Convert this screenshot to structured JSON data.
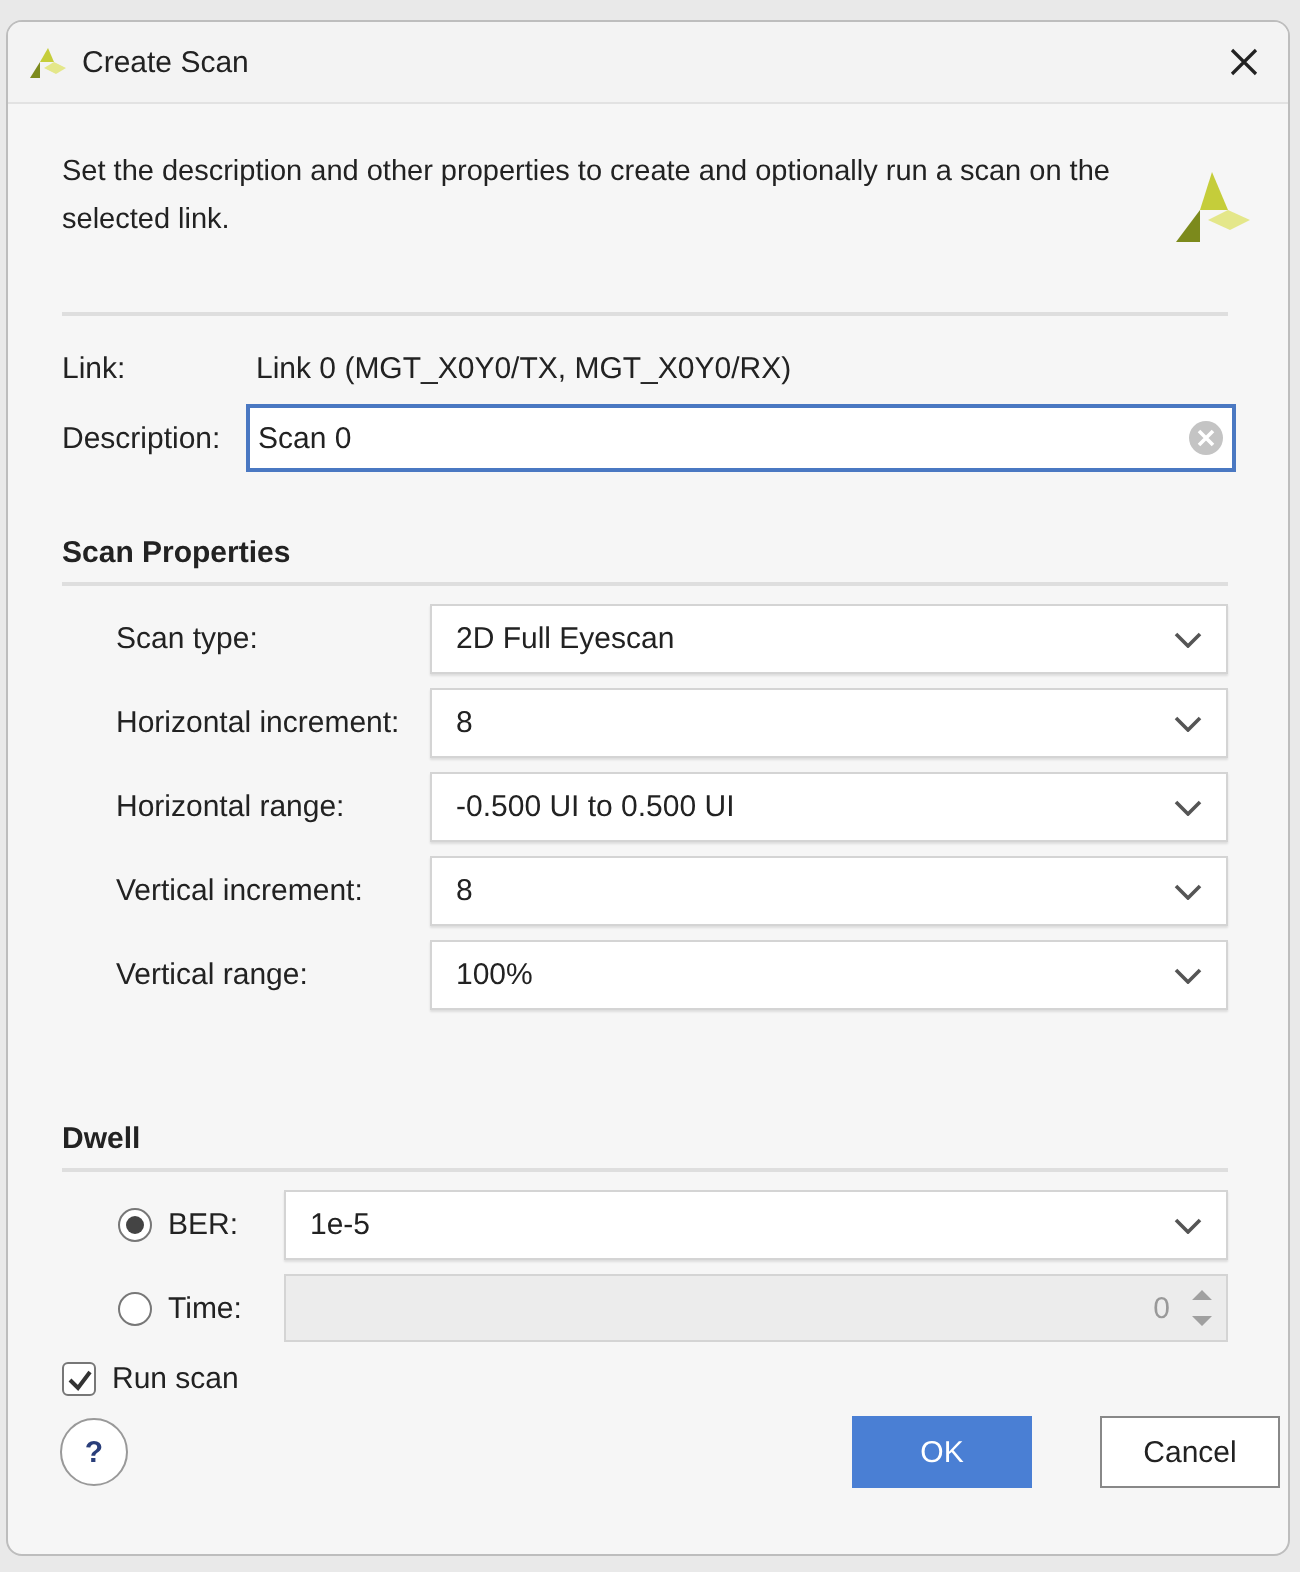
{
  "window": {
    "title": "Create Scan"
  },
  "intro": "Set the description and other properties to create and optionally run a scan on the selected link.",
  "link": {
    "label": "Link:",
    "value": "Link 0 (MGT_X0Y0/TX, MGT_X0Y0/RX)"
  },
  "description": {
    "label": "Description:",
    "value": "Scan 0"
  },
  "scan_properties": {
    "title": "Scan Properties",
    "fields": [
      {
        "label": "Scan type:",
        "value": "2D Full Eyescan"
      },
      {
        "label": "Horizontal increment:",
        "value": "8"
      },
      {
        "label": "Horizontal range:",
        "value": "-0.500 UI to 0.500 UI"
      },
      {
        "label": "Vertical increment:",
        "value": "8"
      },
      {
        "label": "Vertical range:",
        "value": "100%"
      }
    ]
  },
  "dwell": {
    "title": "Dwell",
    "options": [
      {
        "label": "BER:",
        "selected": true,
        "kind": "dropdown",
        "value": "1e-5",
        "disabled": false
      },
      {
        "label": "Time:",
        "selected": false,
        "kind": "spinner",
        "value": "0",
        "disabled": true
      }
    ]
  },
  "run_scan": {
    "label": "Run scan",
    "checked": true
  },
  "buttons": [
    {
      "label": "?",
      "kind": "help"
    },
    {
      "label": "OK",
      "kind": "primary"
    },
    {
      "label": "Cancel",
      "kind": "secondary"
    }
  ]
}
